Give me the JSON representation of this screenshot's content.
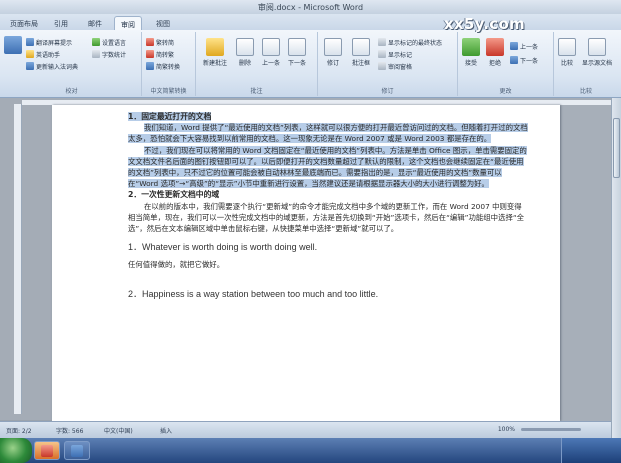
{
  "window": {
    "title": "审阅.docx - Microsoft Word"
  },
  "watermark": "xx5y.com",
  "tabs": [
    "页面布局",
    "引用",
    "邮件",
    "审阅",
    "视图"
  ],
  "active_tab": "审阅",
  "ribbon": {
    "proofing_group": "校对",
    "proofing_rows": [
      "翻译屏幕提示",
      "设置语言",
      "字数统计",
      "新建批注",
      "英语助手",
      "更新输入法词典"
    ],
    "chinese_group": "中文简繁转换",
    "chinese_rows": [
      "繁转简",
      "简转繁",
      "简繁转换"
    ],
    "comments_group": "批注",
    "comments_buttons": [
      "新建批注",
      "删除",
      "上一条",
      "下一条"
    ],
    "tracking_group": "修订",
    "tracking_buttons": [
      "修订",
      "批注框",
      "显示标记的最终状态",
      "显示标记",
      "审阅窗格"
    ],
    "changes_group": "更改",
    "changes_buttons": [
      "接受",
      "拒绝",
      "上一条",
      "下一条"
    ],
    "compare_group": "比较",
    "compare_buttons": [
      "比较",
      "显示源文档"
    ]
  },
  "document": {
    "h1": "1．固定最近打开的文档",
    "p1": "我们知道，Word 提供了“最近使用的文档”列表，这样就可以很方便的打开最近曾访问过的文档。但随着打开过的文档太多，恐怕就会下大容易找到以前常用的文档。这一现象无论是在 Word 2007 或是 Word 2003 都是存在的。",
    "p2": "不过，我们现在可以将常用的 Word 文档固定在“最近使用的文档”列表中。方法是单击 Office 图示，单击需要固定的文文档文件名后面的图钉按钮即可以了。以后即便打开的文档数量超过了默认的限制，这个文档也会继续固定在“最近使用的文档”列表中，只不过它的位置可能会被自动林林至最底端而已。需要指出的是，显示“最近使用的文档”数量可以在“Word 选项”→“高级”的“显示”小节中重新进行设置，当然建议还是请根据显示器大小的大小进行调整为好。",
    "h2": "2．一次性更新文档中的域",
    "p3": "在以前的版本中，我们需要逐个执行“更新域”的命令才能完成文档中多个域的更新工作，而在 Word 2007 中则变得相当简单，现在，我们可以一次性完成文档中的域更新，方法是首先切换到“开始”选项卡，然后在“编辑”功能组中选择“全选”，然后在文本编辑区域中单击鼠标右键，从快捷菜单中选择“更新域”就可以了。",
    "en1": "1．Whatever is worth doing is worth doing well.",
    "cn1": "任何值得做的，就把它做好。",
    "en2": "2．Happiness is a way station between too much and too little."
  },
  "status": {
    "page": "页面: 2/2",
    "words": "字数: 566",
    "lang": "中文(中国)",
    "mode": "插入",
    "zoom": "100%"
  }
}
